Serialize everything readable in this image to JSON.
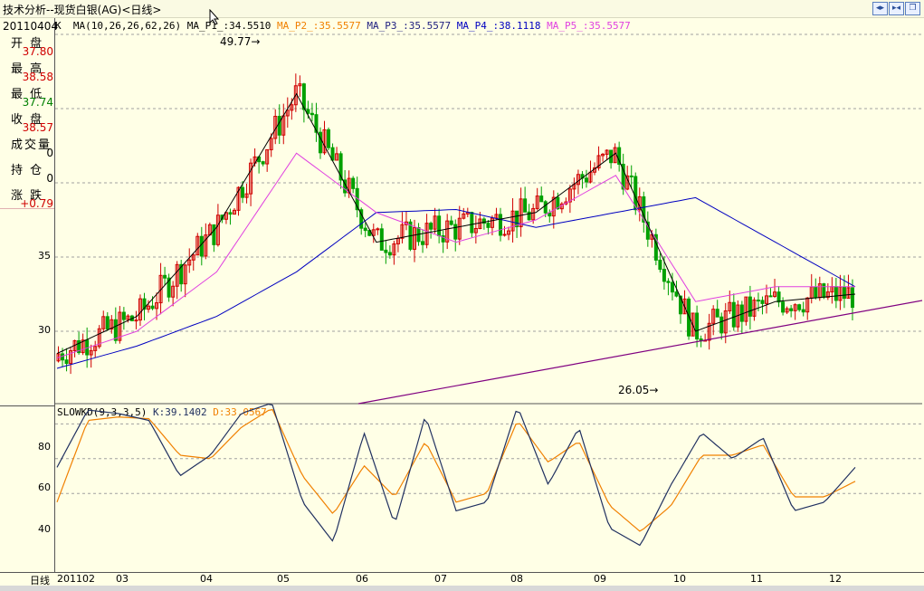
{
  "window": {
    "title": "技术分析--现货白银(AG)<日线>",
    "buttons": [
      "prev-icon",
      "next-icon",
      "restore-icon"
    ]
  },
  "info_panel": {
    "date": "20110404",
    "k_label": "K",
    "fields": [
      {
        "label": "开 盘",
        "value": "37.80",
        "color": "#d00000"
      },
      {
        "label": "最 高",
        "value": "38.58",
        "color": "#d00000"
      },
      {
        "label": "最 低",
        "value": "37.74",
        "color": "#008000"
      },
      {
        "label": "收 盘",
        "value": "38.57",
        "color": "#d00000"
      },
      {
        "label": "成交量",
        "value": "0",
        "color": "#000000"
      },
      {
        "label": "持 仓",
        "value": "0",
        "color": "#000000"
      },
      {
        "label": "涨 跌",
        "value": "+0.79",
        "color": "#d00000"
      }
    ]
  },
  "ma_header": {
    "params": "MA(10,26,26,62,26)",
    "items": [
      {
        "text": "MA_P1_:34.5510",
        "color": "#000000"
      },
      {
        "text": "MA_P2_:35.5577",
        "color": "#f08000"
      },
      {
        "text": "MA_P3_:35.5577",
        "color": "#202080"
      },
      {
        "text": "MA_P4_:38.1118",
        "color": "#0000c0"
      },
      {
        "text": "MA_P5_:35.5577",
        "color": "#e040e0"
      }
    ]
  },
  "kd_header": {
    "params": "SLOWKD(9,3,3,5)",
    "k": "K:39.1402",
    "d": "D:33.0567"
  },
  "price_axis": {
    "labels": [
      "35",
      "30"
    ]
  },
  "kd_axis": {
    "labels": [
      "80",
      "60",
      "40"
    ]
  },
  "annotations": {
    "high": "49.77",
    "low": "26.05"
  },
  "x_axis": {
    "period_label": "日线",
    "labels": [
      "201102",
      "03",
      "04",
      "05",
      "06",
      "07",
      "08",
      "09",
      "10",
      "11",
      "12"
    ]
  },
  "colors": {
    "up_candle": "#d00000",
    "down_candle": "#00a000",
    "ma1": "#000000",
    "ma4": "#0000c0",
    "ma5": "#e040e0",
    "trendline": "#800080",
    "kd_k": "#203060",
    "kd_d": "#f08000",
    "grid": "#a0a0a0"
  },
  "chart_data": {
    "type": "line",
    "series": [
      {
        "name": "MA_P1_",
        "x": [
          "201102",
          "03",
          "04",
          "05",
          "06",
          "07",
          "08",
          "09",
          "10",
          "11",
          "12"
        ],
        "values": [
          28.5,
          31.0,
          37.0,
          46.0,
          36.0,
          37.0,
          38.0,
          42.0,
          30.0,
          32.0,
          32.5
        ]
      },
      {
        "name": "MA_P4_",
        "x": [
          "201102",
          "03",
          "04",
          "05",
          "06",
          "07",
          "08",
          "09",
          "10",
          "11",
          "12"
        ],
        "values": [
          27.5,
          29.0,
          31.0,
          34.0,
          38.0,
          38.2,
          37.0,
          38.0,
          39.0,
          36.0,
          33.0
        ]
      },
      {
        "name": "MA_P5_",
        "x": [
          "201102",
          "03",
          "04",
          "05",
          "06",
          "07",
          "08",
          "09",
          "10",
          "11",
          "12"
        ],
        "values": [
          28.2,
          30.0,
          34.0,
          42.0,
          38.0,
          36.0,
          37.5,
          40.5,
          32.0,
          33.0,
          33.0
        ]
      }
    ],
    "kd": {
      "name": "SLOWKD(9,3,3,5)",
      "ylim": [
        0,
        100
      ],
      "k": [
        55,
        88,
        86,
        82,
        50,
        62,
        86,
        92,
        35,
        12,
        75,
        22,
        85,
        30,
        35,
        90,
        45,
        78,
        20,
        10,
        45,
        75,
        60,
        72,
        30,
        35,
        55
      ],
      "d": [
        35,
        82,
        84,
        83,
        62,
        60,
        78,
        89,
        50,
        28,
        56,
        38,
        70,
        35,
        40,
        82,
        58,
        70,
        33,
        18,
        33,
        62,
        62,
        68,
        38,
        38,
        47
      ]
    },
    "ylim": [
      24,
      52
    ]
  }
}
